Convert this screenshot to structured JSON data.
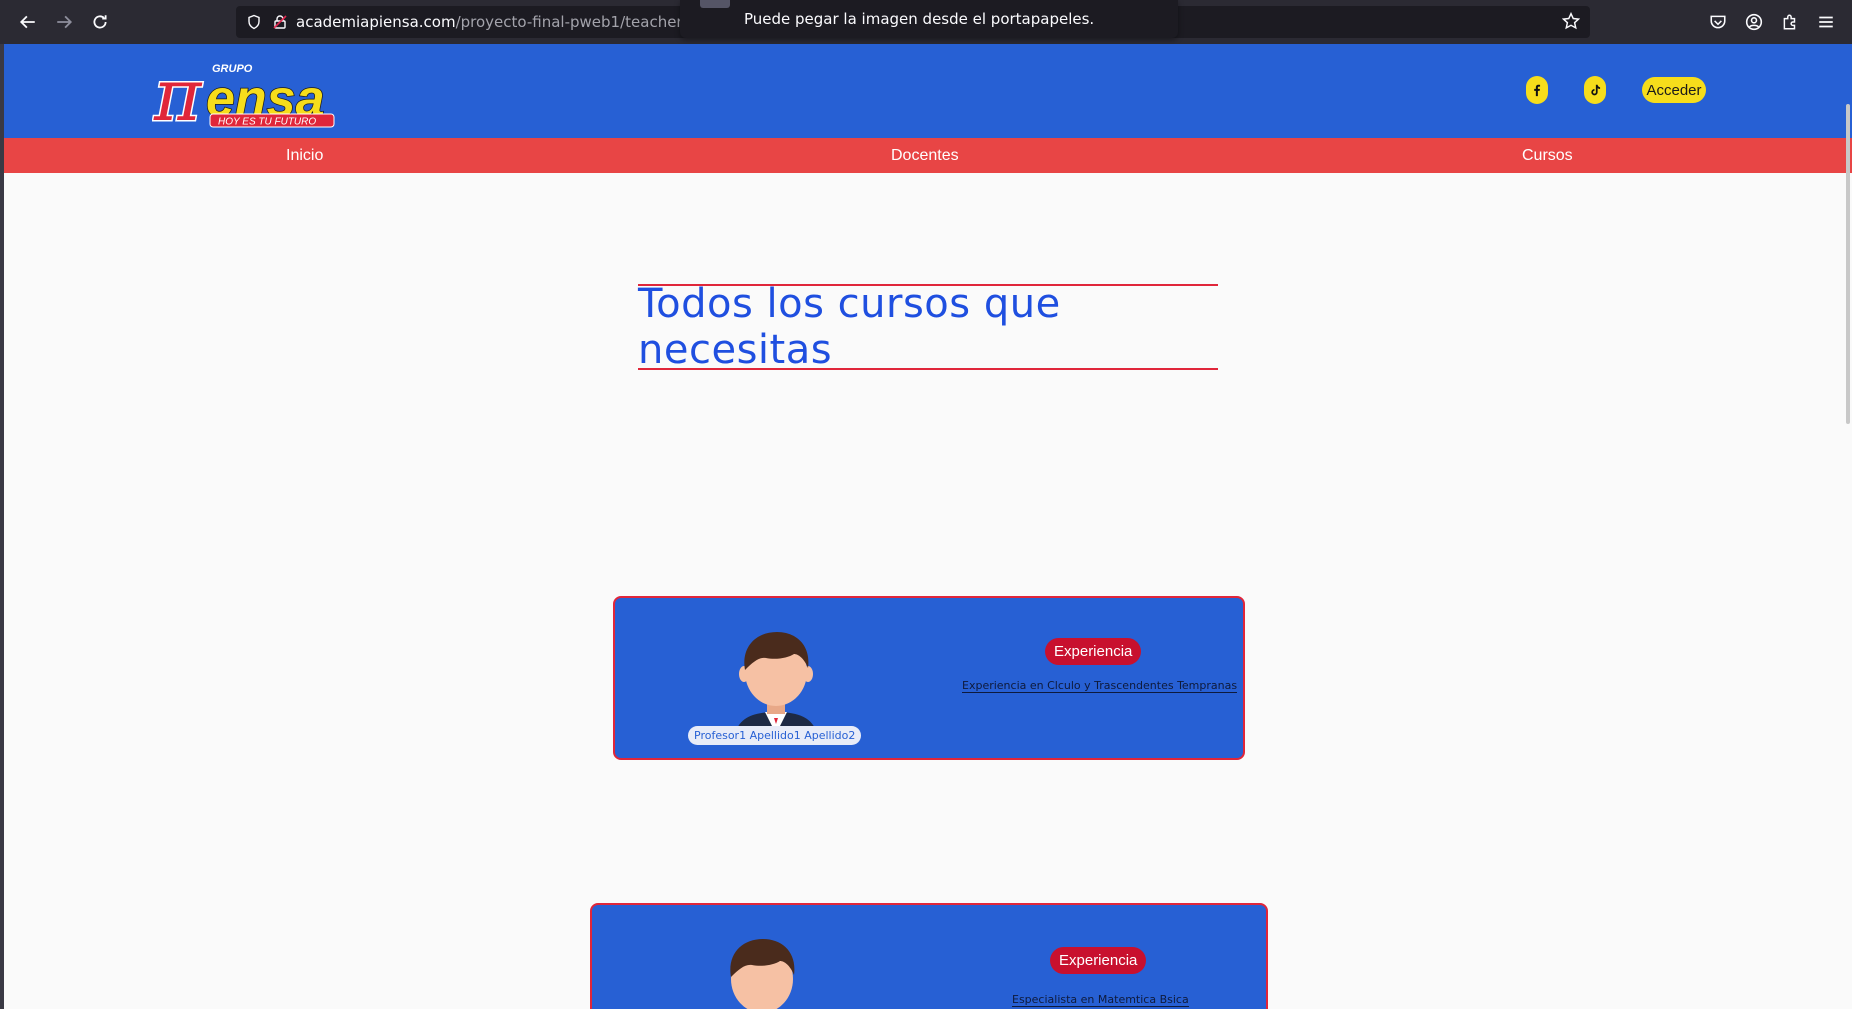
{
  "browser": {
    "url_host": "academiapiensa.com",
    "url_path": "/proyecto-final-pweb1/teachers.h",
    "toast_message": "Puede pegar la imagen desde el portapapeles."
  },
  "site": {
    "logo": {
      "grupo": "GRUPO",
      "pi": "π",
      "word": "ensa",
      "tagline": "HOY ES TU FUTURO"
    },
    "social": [
      "facebook-icon",
      "tiktok-icon"
    ],
    "login_label": "Acceder",
    "nav": [
      "Inicio",
      "Docentes",
      "Cursos"
    ],
    "section_title": "Todos los cursos que necesitas"
  },
  "teachers": [
    {
      "name": "Profesor1 Apellido1 Apellido2",
      "badge": "Experiencia",
      "experience": "Experiencia en Clculo y Trascendentes Tempranas"
    },
    {
      "name": "",
      "badge": "Experiencia",
      "experience": "Especialista en Matemtica Bsica"
    }
  ],
  "colors": {
    "header_blue": "#2760d4",
    "nav_red": "#e84545",
    "accent_yellow": "#f6dd1b",
    "title_blue": "#1f4fe0",
    "badge_red": "#c8102e"
  }
}
